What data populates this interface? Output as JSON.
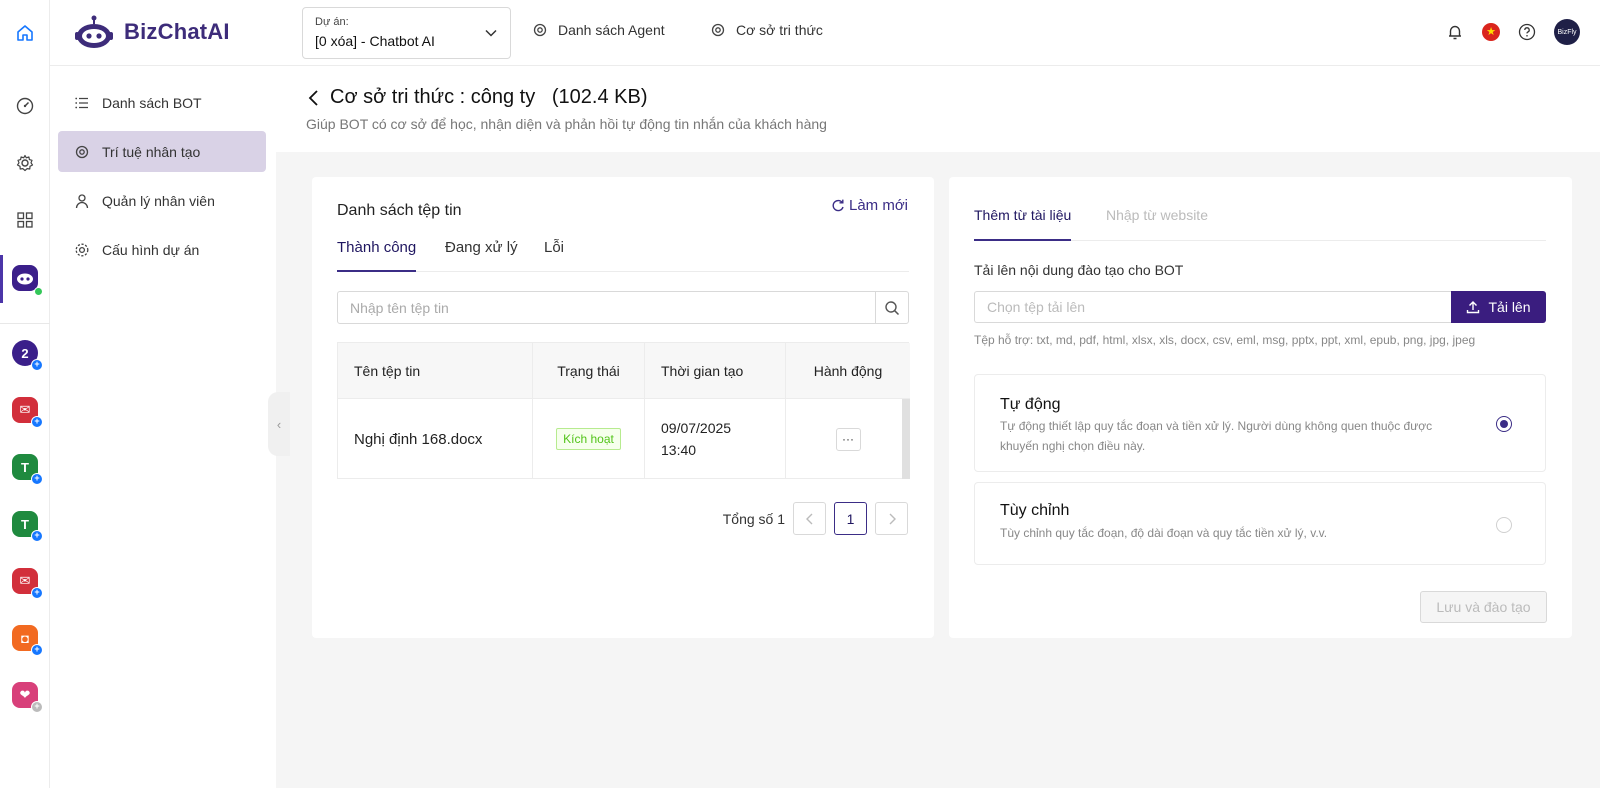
{
  "header": {
    "brand": "BizChatAI",
    "project_label": "Dự án:",
    "project_value": "[0 xóa] - Chatbot AI",
    "nav": [
      {
        "label": "Danh sách Agent",
        "icon": "openai-icon"
      },
      {
        "label": "Cơ sở tri thức",
        "icon": "openai-icon"
      }
    ],
    "flag_star": "★",
    "avatar_text": "BizFly"
  },
  "rail": {
    "apps": [
      {
        "name": "app-bizchat",
        "color": "#3b1f8a",
        "glyph": "◉"
      },
      {
        "name": "app-1",
        "color": "#3b1f8a",
        "glyph": "2"
      },
      {
        "name": "app-mail",
        "color": "#d22f3b",
        "glyph": "✉"
      },
      {
        "name": "app-t1",
        "color": "#1f8a3f",
        "glyph": "T"
      },
      {
        "name": "app-t2",
        "color": "#1f8a3f",
        "glyph": "T"
      },
      {
        "name": "app-mail2",
        "color": "#d22f3b",
        "glyph": "✉"
      },
      {
        "name": "app-shop",
        "color": "#f26a21",
        "glyph": "◘"
      },
      {
        "name": "app-love",
        "color": "#d8407a",
        "glyph": "❤"
      }
    ]
  },
  "sidebar": {
    "items": [
      {
        "label": "Danh sách BOT",
        "icon": "list-icon"
      },
      {
        "label": "Trí tuệ nhân tạo",
        "icon": "openai-icon"
      },
      {
        "label": "Quản lý nhân viên",
        "icon": "user-icon"
      },
      {
        "label": "Cấu hình dự án",
        "icon": "gear-icon"
      }
    ]
  },
  "page": {
    "title": "Cơ sở tri thức : công ty   (102.4 KB)",
    "subtitle": "Giúp BOT có cơ sở để học, nhận diện và phản hồi tự động tin nhắn của khách hàng"
  },
  "files": {
    "title": "Danh sách tệp tin",
    "refresh_label": "Làm mới",
    "tabs": [
      "Thành công",
      "Đang xử lý",
      "Lỗi"
    ],
    "search_placeholder": "Nhập tên tệp tin",
    "columns": [
      "Tên tệp tin",
      "Trạng thái",
      "Thời gian tạo",
      "Hành động"
    ],
    "rows": [
      {
        "name": "Nghị định 168.docx",
        "status": "Kích hoạt",
        "date": "09/07/2025",
        "time": "13:40",
        "action": "···"
      }
    ],
    "total_label": "Tổng số 1",
    "current_page": "1"
  },
  "upload": {
    "tabs": [
      "Thêm từ tài liệu",
      "Nhập từ website"
    ],
    "label": "Tải lên nội dung đào tạo cho BOT",
    "placeholder": "Chọn tệp tải lên",
    "button": "Tải lên",
    "formats": "Tệp hỗ trợ: txt, md, pdf, html, xlsx, xls, docx, csv, eml, msg, pptx, ppt, xml, epub, png, jpg, jpeg",
    "options": [
      {
        "title": "Tự động",
        "desc": "Tự động thiết lập quy tắc đoạn và tiền xử lý. Người dùng không quen thuộc được khuyến nghị chọn điều này.",
        "selected": true
      },
      {
        "title": "Tùy chỉnh",
        "desc": "Tùy chỉnh quy tắc đoạn, độ dài đoạn và quy tắc tiền xử lý, v.v.",
        "selected": false
      }
    ],
    "save_label": "Lưu và đào tạo"
  },
  "colors": {
    "accent": "#3b2d86",
    "primary_button": "#3a1d7f",
    "active_menu": "#d9d2e6",
    "success": "#52c41a"
  }
}
